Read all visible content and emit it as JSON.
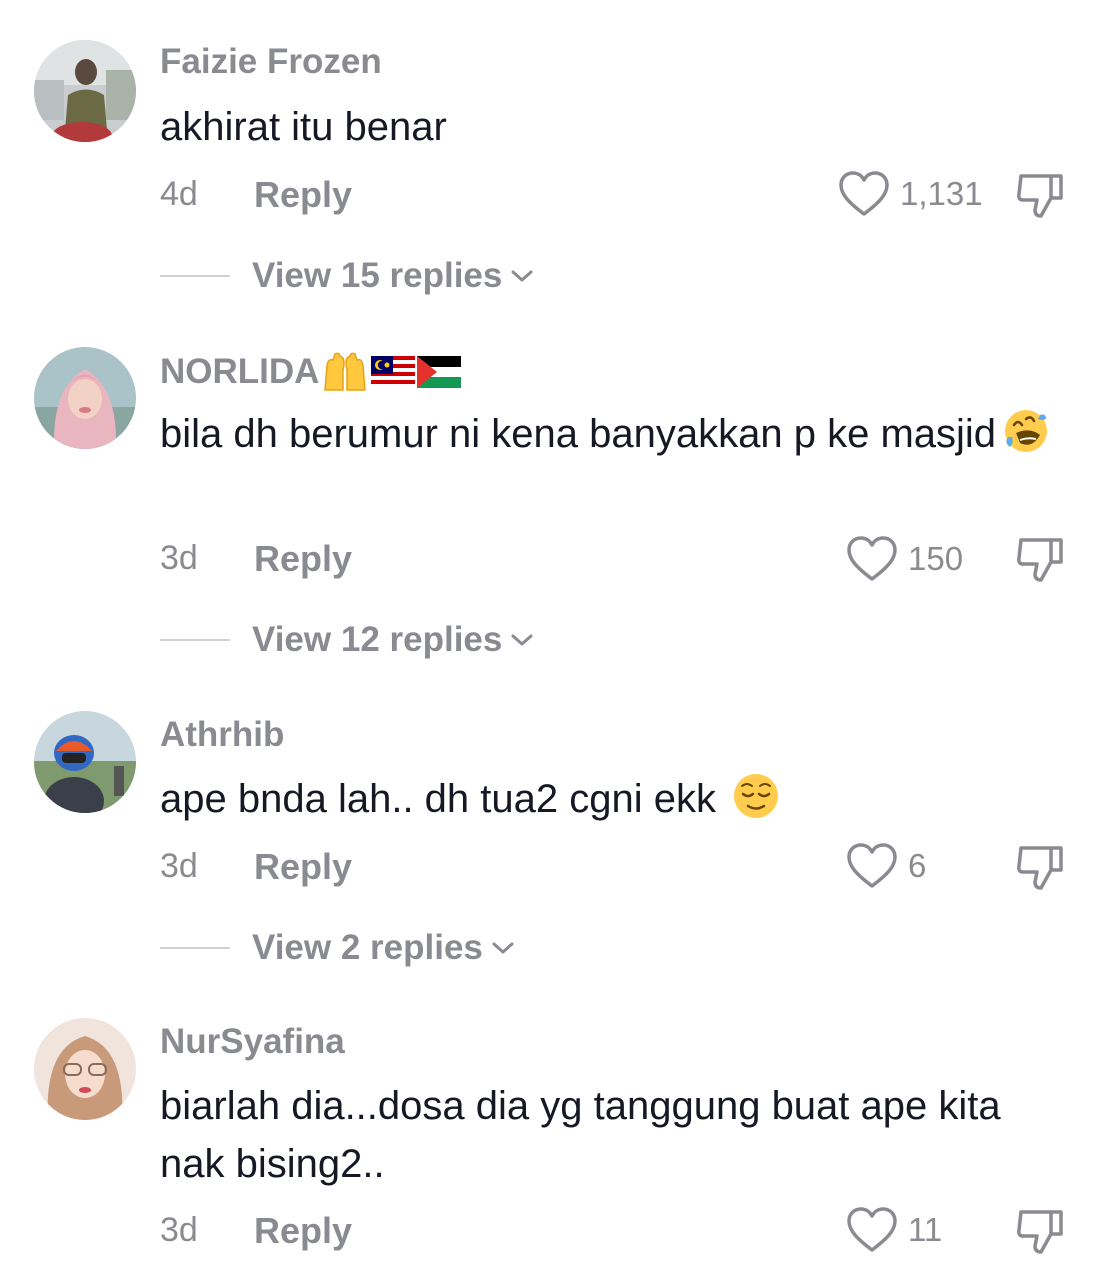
{
  "comments": [
    {
      "username": "Faizie Frozen",
      "text": "akhirat itu benar",
      "age": "4d",
      "reply_label": "Reply",
      "likes": "1,131",
      "view_replies": "View 15 replies"
    },
    {
      "username": "NORLIDA",
      "username_emojis": [
        "raised-hands-emoji",
        "malaysia-flag",
        "palestine-flag"
      ],
      "text": "bila dh berumur ni kena banyakkan p ke masjid",
      "text_emoji": "rolling-on-floor-laughing-emoji",
      "age": "3d",
      "reply_label": "Reply",
      "likes": "150",
      "view_replies": "View 12 replies"
    },
    {
      "username": "Athrhib",
      "text": "ape bnda lah.. dh tua2 cgni ekk",
      "text_emoji": "relieved-face-emoji",
      "age": "3d",
      "reply_label": "Reply",
      "likes": "6",
      "view_replies": "View 2 replies"
    },
    {
      "username": "NurSyafina",
      "text": "biarlah dia...dosa dia yg tanggung buat ape kita nak bising2..",
      "age": "3d",
      "reply_label": "Reply",
      "likes": "11"
    }
  ],
  "colors": {
    "text_primary": "#161823",
    "text_secondary": "#8a8b91",
    "divider": "#d0d1d3",
    "background": "#ffffff"
  }
}
